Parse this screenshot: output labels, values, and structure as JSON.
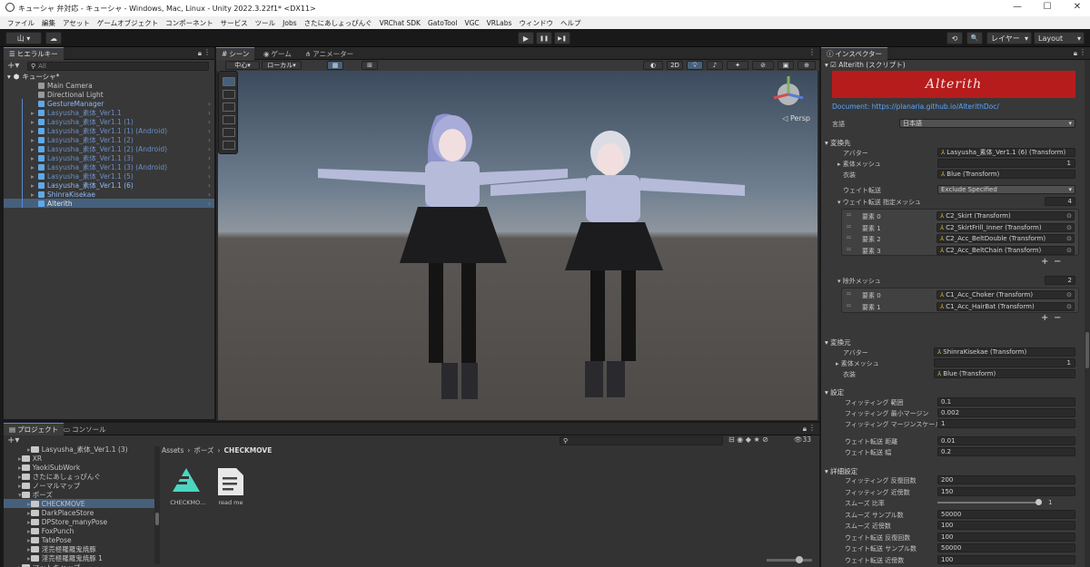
{
  "window": {
    "title": "キューシャ 弁対応 - キューシャ - Windows, Mac, Linux - Unity 2022.3.22f1* <DX11>",
    "min": "—",
    "max": "☐",
    "close": "✕"
  },
  "menu": [
    "ファイル",
    "編集",
    "アセット",
    "ゲームオブジェクト",
    "コンポーネント",
    "サービス",
    "ツール",
    "Jobs",
    "さたにあしょっぴんぐ",
    "VRChat SDK",
    "GatoTool",
    "VGC",
    "VRLabs",
    "ウィンドウ",
    "ヘルプ"
  ],
  "toolbar": {
    "account": "山 ▾",
    "cloud": "☁",
    "play": "▶",
    "pause": "❚❚",
    "step": "▶❚",
    "history": "⟲",
    "search": "🔍",
    "layers": "レイヤー",
    "layout": "Layout"
  },
  "hierarchy": {
    "tab": "ヒエラルキー",
    "search_placeholder": "All",
    "scene": "キューシャ*",
    "items": [
      {
        "label": "Main Camera",
        "style": "normal",
        "indent": 1
      },
      {
        "label": "Directional Light",
        "style": "normal",
        "indent": 1
      },
      {
        "label": "GestureManager",
        "style": "blue",
        "indent": 1
      },
      {
        "label": "Lasyusha_素体_Ver1.1",
        "style": "blue-dim",
        "indent": 1
      },
      {
        "label": "Lasyusha_素体_Ver1.1 (1)",
        "style": "blue-dim",
        "indent": 1
      },
      {
        "label": "Lasyusha_素体_Ver1.1 (1) (Android)",
        "style": "blue-dim",
        "indent": 1
      },
      {
        "label": "Lasyusha_素体_Ver1.1 (2)",
        "style": "blue-dim",
        "indent": 1
      },
      {
        "label": "Lasyusha_素体_Ver1.1 (2) (Android)",
        "style": "blue-dim",
        "indent": 1
      },
      {
        "label": "Lasyusha_素体_Ver1.1 (3)",
        "style": "blue-dim",
        "indent": 1
      },
      {
        "label": "Lasyusha_素体_Ver1.1 (3) (Android)",
        "style": "blue-dim",
        "indent": 1
      },
      {
        "label": "Lasyusha_素体_Ver1.1 (5)",
        "style": "blue-dim",
        "indent": 1
      },
      {
        "label": "Lasyusha_素体_Ver1.1 (6)",
        "style": "blue",
        "indent": 1
      },
      {
        "label": "ShinraKisekae",
        "style": "blue",
        "indent": 1
      },
      {
        "label": "Alterith",
        "style": "selected",
        "indent": 1
      }
    ]
  },
  "scene_view": {
    "tabs": [
      "シーン",
      "ゲーム",
      "アニメーター"
    ],
    "pivot": "中心",
    "space": "ローカル",
    "mode2d": "2D",
    "persp": "◁ Persp"
  },
  "project": {
    "tabs": [
      "プロジェクト",
      "コンソール"
    ],
    "tree": [
      {
        "label": "Lasyusha_素体_Ver1.1 (3)",
        "indent": 2
      },
      {
        "label": "XR",
        "indent": 1
      },
      {
        "label": "YaokiSubWork",
        "indent": 1
      },
      {
        "label": "さたにあしょっぴんぐ",
        "indent": 1
      },
      {
        "label": "ノーマルマップ",
        "indent": 1
      },
      {
        "label": "ポーズ",
        "indent": 1
      },
      {
        "label": "CHECKMOVE",
        "indent": 2
      },
      {
        "label": "DarkPlaceStore",
        "indent": 2
      },
      {
        "label": "DPStore_manyPose",
        "indent": 2
      },
      {
        "label": "FoxPunch",
        "indent": 2
      },
      {
        "label": "TatePose",
        "indent": 2
      },
      {
        "label": "淫売極羅羅鬼焼豚",
        "indent": 2
      },
      {
        "label": "淫売極羅羅鬼焼豚 1",
        "indent": 2
      },
      {
        "label": "マットキャップ",
        "indent": 1
      }
    ],
    "breadcrumb": [
      "Assets",
      "ポーズ",
      "CHECKMOVE"
    ],
    "assets": [
      {
        "label": "CHECKMO…"
      },
      {
        "label": "read me"
      }
    ],
    "hidden_count": "33"
  },
  "inspector": {
    "tab": "インスペクター",
    "component": "Alterith (スクリプト)",
    "banner": "Alterith",
    "doc": "Document: https://planaria.github.io/AlterithDoc/",
    "language_label": "言語",
    "language_value": "日本語",
    "dest_header": "変換先",
    "dest": {
      "avatar_label": "アバター",
      "avatar_value": "Lasyusha_素体_Ver1.1 (6) (Transform)",
      "body_label": "素体メッシュ",
      "body_value": "1",
      "clothes_label": "衣装",
      "clothes_value": "Blue (Transform)",
      "weight_label": "ウェイト転送",
      "weight_value": "Exclude Specified",
      "wmesh_label": "ウェイト転送 指定メッシュ",
      "wmesh_count": "4",
      "wmesh": [
        {
          "label": "要素 0",
          "value": "C2_Skirt (Transform)"
        },
        {
          "label": "要素 1",
          "value": "C2_SkirtFrill_Inner (Transform)"
        },
        {
          "label": "要素 2",
          "value": "C2_Acc_BeltDouble (Transform)"
        },
        {
          "label": "要素 3",
          "value": "C2_Acc_BeltChain (Transform)"
        }
      ],
      "excl_label": "除外メッシュ",
      "excl_count": "2",
      "excl": [
        {
          "label": "要素 0",
          "value": "C1_Acc_Choker (Transform)"
        },
        {
          "label": "要素 1",
          "value": "C1_Acc_HairBat (Transform)"
        }
      ]
    },
    "src_header": "変換元",
    "src": {
      "avatar_label": "アバター",
      "avatar_value": "ShinraKisekae (Transform)",
      "body_label": "素体メッシュ",
      "body_value": "1",
      "clothes_label": "衣装",
      "clothes_value": "Blue (Transform)"
    },
    "settings_header": "設定",
    "settings": [
      {
        "label": "フィッティング 範囲",
        "value": "0.1"
      },
      {
        "label": "フィッティング 最小マージン",
        "value": "0.002"
      },
      {
        "label": "フィッティング マージンスケール",
        "value": "1"
      },
      {
        "label": "ウェイト転送 距離",
        "value": "0.01"
      },
      {
        "label": "ウェイト転送 幅",
        "value": "0.2"
      }
    ],
    "adv_header": "詳細設定",
    "adv": [
      {
        "label": "フィッティング 反復回数",
        "value": "200"
      },
      {
        "label": "フィッティング 近傍数",
        "value": "150"
      },
      {
        "label": "スムーズ 比率",
        "value": "1"
      },
      {
        "label": "スムーズ サンプル数",
        "value": "50000"
      },
      {
        "label": "スムーズ 近傍数",
        "value": "100"
      },
      {
        "label": "ウェイト転送 反復回数",
        "value": "100"
      },
      {
        "label": "ウェイト転送 サンプル数",
        "value": "50000"
      },
      {
        "label": "ウェイト転送 近傍数",
        "value": "100"
      }
    ]
  },
  "colors": {
    "accent": "#5a8ad6",
    "banner": "#b71c1c",
    "link": "#58a6ff",
    "prefab_blue": "#7ea7e6"
  }
}
